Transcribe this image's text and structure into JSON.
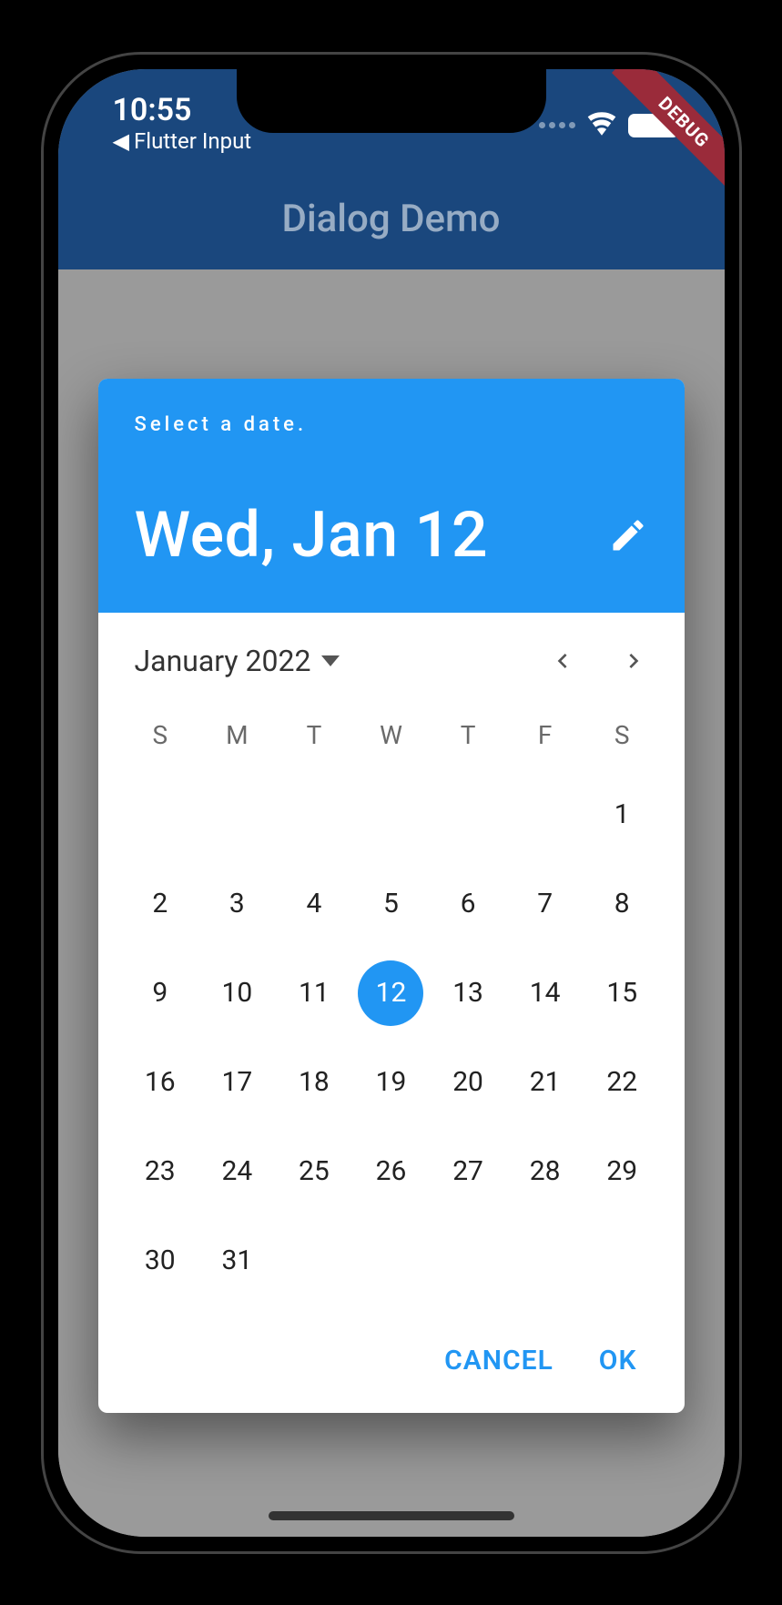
{
  "status": {
    "time": "10:55",
    "back_label": "Flutter Input"
  },
  "debug_banner": "DEBUG",
  "app_bar": {
    "title": "Dialog Demo"
  },
  "date_picker": {
    "help_text": "Select a date.",
    "selected_date_label": "Wed, Jan 12",
    "month_year_label": "January 2022",
    "dow": [
      "S",
      "M",
      "T",
      "W",
      "T",
      "F",
      "S"
    ],
    "leading_blanks": 6,
    "days_in_month": 31,
    "selected_day": 12,
    "actions": {
      "cancel": "CANCEL",
      "ok": "OK"
    }
  }
}
